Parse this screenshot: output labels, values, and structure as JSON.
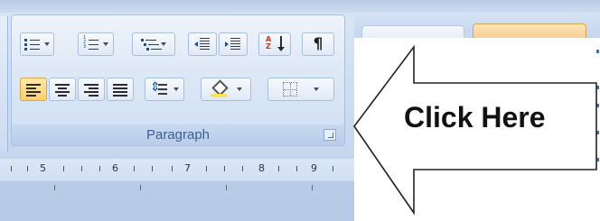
{
  "paragraph_group": {
    "label": "Paragraph",
    "buttons_row1": [
      {
        "name": "bullets-button",
        "icon": "bullets-icon",
        "has_dropdown": true
      },
      {
        "name": "numbering-button",
        "icon": "numbering-icon",
        "has_dropdown": true
      },
      {
        "name": "multilevel-list-button",
        "icon": "multilevel-list-icon",
        "has_dropdown": true
      },
      {
        "name": "decrease-indent-button",
        "icon": "decrease-indent-icon",
        "has_dropdown": false
      },
      {
        "name": "increase-indent-button",
        "icon": "increase-indent-icon",
        "has_dropdown": false
      },
      {
        "name": "sort-button",
        "icon": "sort-icon",
        "has_dropdown": false
      },
      {
        "name": "show-hide-button",
        "icon": "pilcrow-icon",
        "has_dropdown": false
      }
    ],
    "buttons_row2": [
      {
        "name": "align-left-button",
        "icon": "align-left-icon",
        "active": true
      },
      {
        "name": "center-button",
        "icon": "align-center-icon",
        "active": false
      },
      {
        "name": "align-right-button",
        "icon": "align-right-icon",
        "active": false
      },
      {
        "name": "justify-button",
        "icon": "justify-icon",
        "active": false
      },
      {
        "name": "line-spacing-button",
        "icon": "line-spacing-icon",
        "has_dropdown": true
      },
      {
        "name": "shading-button",
        "icon": "shading-icon",
        "has_dropdown": true
      },
      {
        "name": "borders-button",
        "icon": "borders-icon",
        "has_dropdown": true
      }
    ],
    "sort_glyph": "A\nZ",
    "pilcrow_glyph": "¶",
    "launcher_icon": "dialog-launcher-icon"
  },
  "ruler": {
    "labels": [
      "5",
      "6",
      "7",
      "8",
      "9"
    ]
  },
  "callout": {
    "text": "Click Here"
  },
  "colors": {
    "ribbon_blue": "#c5d6ec",
    "active_button": "#ffcf6b",
    "label_text": "#3c5f98"
  }
}
